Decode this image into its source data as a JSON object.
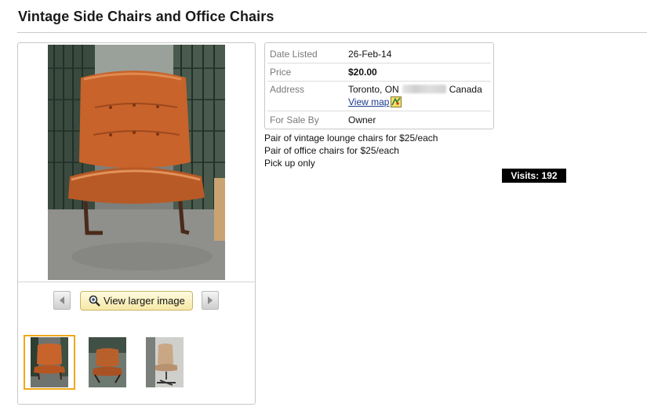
{
  "listing": {
    "title": "Vintage Side Chairs and Office Chairs",
    "visits_text": "Visits: 192"
  },
  "gallery": {
    "larger_image_label": "View larger image",
    "thumbnail_count": 3,
    "selected_thumbnail": 1
  },
  "details": {
    "date_label": "Date Listed",
    "date_value": "26-Feb-14",
    "price_label": "Price",
    "price_value": "$20.00",
    "address_label": "Address",
    "address_city": "Toronto, ON",
    "address_country": "Canada",
    "view_map_label": "View map",
    "forsale_label": "For Sale By",
    "forsale_value": "Owner"
  },
  "description": [
    "Pair of vintage lounge chairs for $25/each",
    "Pair of office chairs for $25/each",
    "Pick up only"
  ],
  "colors": {
    "accent_thumb_border": "#f2a81a",
    "link": "#1e3c8e",
    "visits_bg": "#000000",
    "chair_leather": "#c8632b"
  },
  "icons": [
    "chevron-left-icon",
    "chevron-right-icon",
    "magnifier-icon",
    "map-icon"
  ]
}
